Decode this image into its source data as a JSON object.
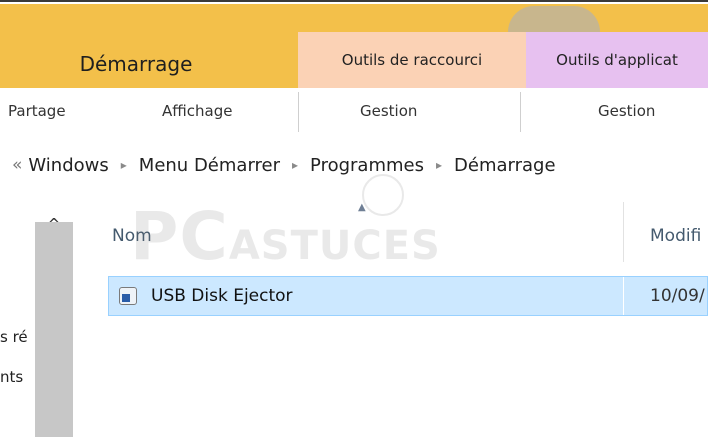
{
  "ribbon": {
    "tabs": {
      "home": "Démarrage",
      "shortcut_tools": "Outils de raccourci",
      "app_tools": "Outils d'applicat"
    },
    "subtabs": {
      "share": "Partage",
      "view": "Affichage",
      "manage_shortcut": "Gestion",
      "manage_app": "Gestion"
    },
    "colors": {
      "ribbon": "#f3c04a",
      "shortcut_tools": "#fbd2b5",
      "app_tools": "#e7c1f0"
    }
  },
  "breadcrumb": {
    "back_symbol": "«",
    "items": [
      "Windows",
      "Menu Démarrer",
      "Programmes",
      "Démarrage"
    ],
    "separator": "▸"
  },
  "nav": {
    "scroll_up_icon": "^",
    "partial_items": [
      "s ré",
      "nts"
    ]
  },
  "file_list": {
    "columns": {
      "name": "Nom",
      "modified": "Modifi"
    },
    "rows": [
      {
        "name": "USB Disk Ejector",
        "modified": "10/09/"
      }
    ],
    "selected_color": "#cce8ff"
  },
  "watermark": {
    "pc": "PC",
    "astuces": "ASTUCES"
  }
}
